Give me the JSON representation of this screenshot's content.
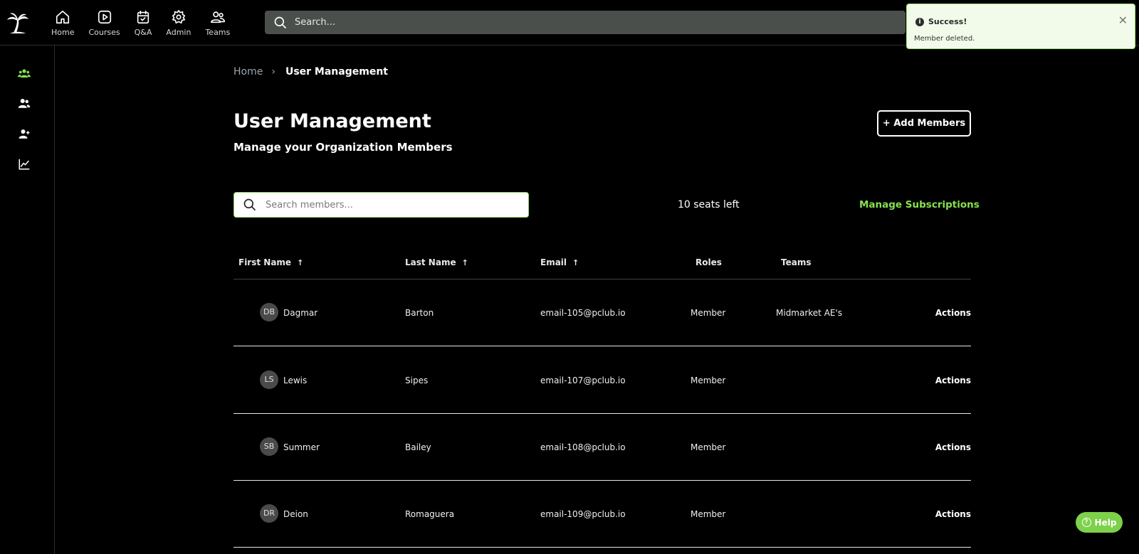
{
  "nav": {
    "items": [
      {
        "label": "Home",
        "icon": "home-icon"
      },
      {
        "label": "Courses",
        "icon": "play-icon"
      },
      {
        "label": "Q&A",
        "icon": "calendar-check-icon"
      },
      {
        "label": "Admin",
        "icon": "gear-icon"
      },
      {
        "label": "Teams",
        "icon": "users-icon"
      }
    ],
    "search_placeholder": "Search..."
  },
  "toast": {
    "title": "Success!",
    "message": "Member deleted.",
    "close": "✕"
  },
  "sidebar": {
    "items": [
      {
        "icon": "organization-icon",
        "active": true
      },
      {
        "icon": "members-icon",
        "active": false
      },
      {
        "icon": "add-member-icon",
        "active": false
      },
      {
        "icon": "analytics-icon",
        "active": false
      }
    ]
  },
  "breadcrumb": {
    "home": "Home",
    "current": "User Management"
  },
  "page": {
    "title": "User Management",
    "subtitle": "Manage your Organization Members",
    "add_button": "+ Add Members",
    "search_placeholder": "Search members...",
    "seats": "10 seats left",
    "manage_subscriptions": "Manage Subscriptions"
  },
  "table": {
    "columns": {
      "first_name": "First Name",
      "last_name": "Last Name",
      "email": "Email",
      "roles": "Roles",
      "teams": "Teams",
      "sort_arrow": "↑"
    },
    "rows": [
      {
        "initials": "DB",
        "first": "Dagmar",
        "last": "Barton",
        "email": "email-105@pclub.io",
        "role": "Member",
        "team": "Midmarket AE's",
        "actions": "Actions"
      },
      {
        "initials": "LS",
        "first": "Lewis",
        "last": "Sipes",
        "email": "email-107@pclub.io",
        "role": "Member",
        "team": "",
        "actions": "Actions"
      },
      {
        "initials": "SB",
        "first": "Summer",
        "last": "Bailey",
        "email": "email-108@pclub.io",
        "role": "Member",
        "team": "",
        "actions": "Actions"
      },
      {
        "initials": "DR",
        "first": "Deion",
        "last": "Romaguera",
        "email": "email-109@pclub.io",
        "role": "Member",
        "team": "",
        "actions": "Actions"
      }
    ]
  },
  "help": {
    "label": "Help",
    "icon": "question-icon"
  },
  "colors": {
    "accent": "#86e24f",
    "toast_bg": "#f2fbe9",
    "background": "#000000"
  }
}
